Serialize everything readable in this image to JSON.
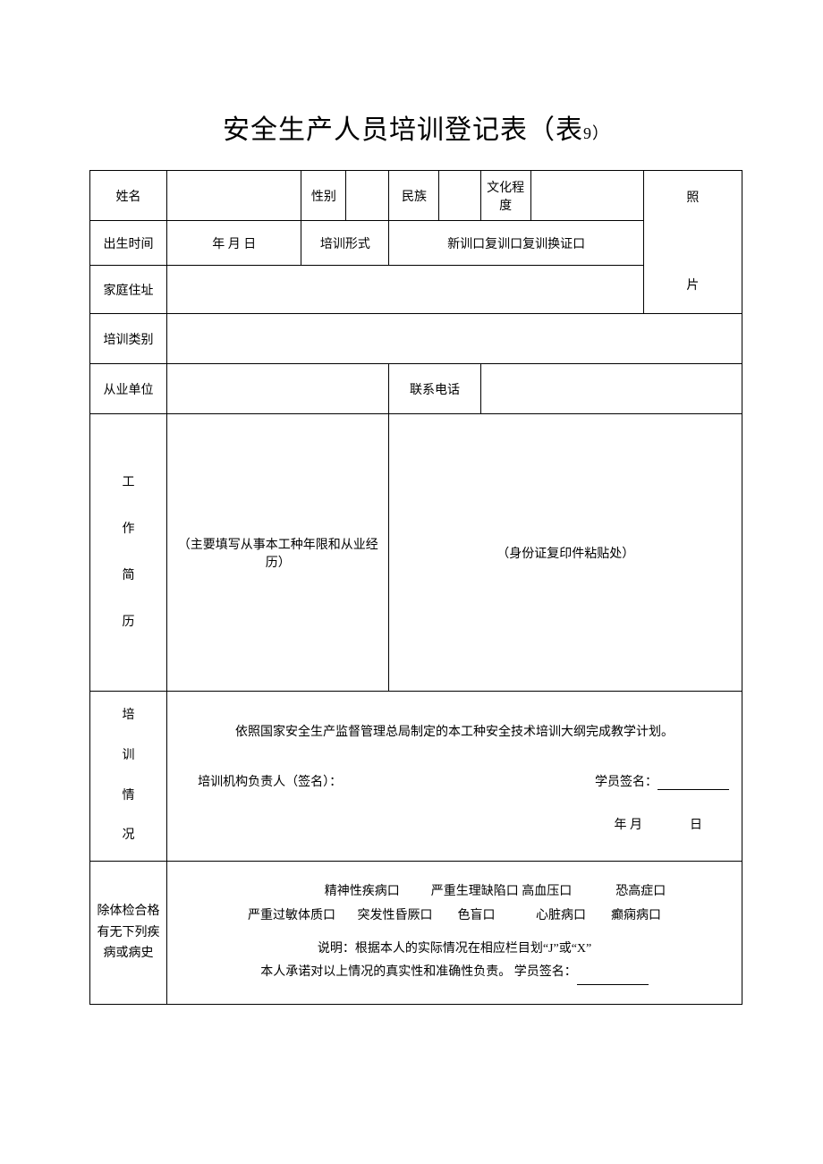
{
  "title_main": "安全生产人员培训登记表（表",
  "title_sub": "9）",
  "labels": {
    "name": "姓名",
    "gender": "性别",
    "ethnic": "民族",
    "edu": "文化程度",
    "photo": "照\n\n片",
    "birth": "出生时间",
    "birth_val": "年 月 日",
    "train_form": "培训形式",
    "train_form_opts": "新训口复训口复训换证口",
    "addr": "家庭住址",
    "train_cat": "培训类别",
    "employer": "从业单位",
    "phone": "联系电话",
    "work_hist": "工\n作\n简\n历",
    "work_note": "（主要填写从事本工种年限和从业经历）",
    "id_copy": "（身份证复印件粘贴处）",
    "train_sit": "培\n训\n情\n况",
    "train_line1": "依照国家安全生产监督管理总局制定的本工种安全技术培训大纲完成教学计划。",
    "train_org_sign": "培训机构负责人（签名）：",
    "student_sign": "学员签名：",
    "date_ym": "年 月",
    "date_d": "日",
    "health_label": "除体检合格有无下列疾病或病史",
    "h_row1": "                          精神性疾病口          严重生理缺陷口 高血压口              恐高症口",
    "h_row2": "严重过敏体质口       突发性昏厥口        色盲口             心脏病口        癫痫病口",
    "h_note1": "说明：根据本人的实际情况在相应栏目划“J”或“X”",
    "h_note2": "          本人承诺对以上情况的真实性和准确性负责。            学员签名："
  }
}
